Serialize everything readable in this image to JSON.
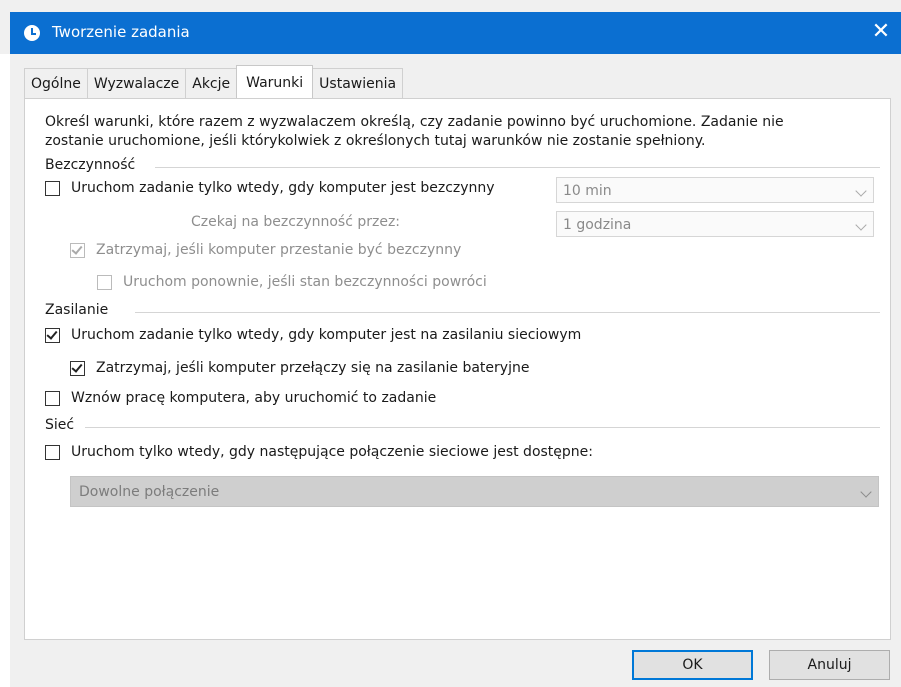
{
  "window": {
    "title": "Tworzenie zadania",
    "close_glyph": "✕",
    "app_icon": "clock-icon"
  },
  "tabs": [
    {
      "label": "Ogólne"
    },
    {
      "label": "Wyzwalacze"
    },
    {
      "label": "Akcje"
    },
    {
      "label": "Warunki",
      "active": true
    },
    {
      "label": "Ustawienia"
    }
  ],
  "description_line1": "Określ warunki, które razem z wyzwalaczem określą, czy zadanie powinno być uruchomione. Zadanie nie",
  "description_line2": "zostanie uruchomione, jeśli którykolwiek z określonych tutaj warunków nie zostanie spełniony.",
  "idle": {
    "group_label": "Bezczynność",
    "start_only_idle": {
      "label": "Uruchom zadanie tylko wtedy, gdy komputer jest bezczynny",
      "checked": false,
      "duration": "10 min"
    },
    "wait_label": "Czekaj na bezczynność przez:",
    "wait_value": "1 godzina",
    "stop_if_not_idle": {
      "label": "Zatrzymaj, jeśli komputer przestanie być bezczynny",
      "checked": true,
      "enabled": false
    },
    "restart_if_idle": {
      "label": "Uruchom ponownie, jeśli stan bezczynności powróci",
      "checked": false,
      "enabled": false
    }
  },
  "power": {
    "group_label": "Zasilanie",
    "ac_only": {
      "label": "Uruchom zadanie tylko wtedy, gdy komputer jest na zasilaniu sieciowym",
      "checked": true
    },
    "stop_on_battery": {
      "label": "Zatrzymaj, jeśli komputer przełączy się na zasilanie bateryjne",
      "checked": true
    },
    "wake": {
      "label": "Wznów pracę komputera, aby uruchomić to zadanie",
      "checked": false
    }
  },
  "network": {
    "group_label": "Sieć",
    "only_if_network": {
      "label": "Uruchom tylko wtedy, gdy następujące połączenie sieciowe jest dostępne:",
      "checked": false
    },
    "connection_value": "Dowolne połączenie"
  },
  "buttons": {
    "ok": "OK",
    "cancel": "Anuluj"
  }
}
